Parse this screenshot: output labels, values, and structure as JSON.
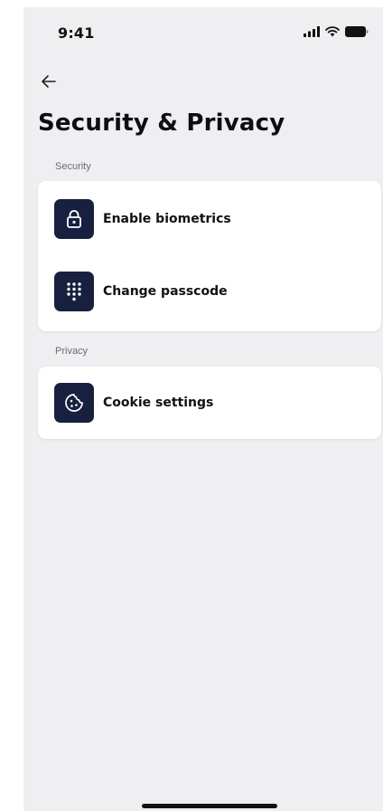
{
  "status_bar": {
    "time": "9:41",
    "icons": [
      "signal-icon",
      "wifi-icon",
      "battery-icon"
    ]
  },
  "header": {
    "back_icon": "arrow-left-icon",
    "title": "Security & Privacy"
  },
  "sections": [
    {
      "label": "Security",
      "items": [
        {
          "label": "Enable biometrics",
          "icon": "lock-icon"
        },
        {
          "label": "Change passcode",
          "icon": "keypad-icon"
        }
      ]
    },
    {
      "label": "Privacy",
      "items": [
        {
          "label": "Cookie settings",
          "icon": "cookie-icon"
        }
      ]
    }
  ],
  "colors": {
    "background": "#efeff1",
    "card": "#ffffff",
    "icon_tile": "#18203f",
    "text": "#111116"
  }
}
